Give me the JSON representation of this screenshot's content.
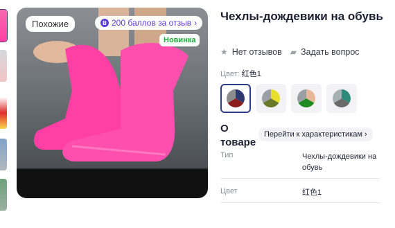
{
  "gallery": {
    "similar_label": "Похожие",
    "bonus_icon": "B",
    "bonus_label": "200 баллов за отзыв",
    "new_badge": "Новинка"
  },
  "product": {
    "title": "Чехлы-дождевики на обувь",
    "no_reviews": "Нет отзывов",
    "ask_question": "Задать вопрос",
    "color_prefix": "Цвет: ",
    "color_value": "红色1",
    "swatches": [
      {
        "name": "navy-red-grey",
        "colors": [
          "#2e3870",
          "#8a1c1c",
          "#8c8c8c"
        ],
        "selected": true
      },
      {
        "name": "yellow-olive-grey",
        "colors": [
          "#e8e02a",
          "#6b7a2a",
          "#9aa0a6"
        ],
        "selected": false
      },
      {
        "name": "peach-green-grey",
        "colors": [
          "#e8b89a",
          "#1f8a1f",
          "#9aa0a6"
        ],
        "selected": false
      },
      {
        "name": "teal-grey",
        "colors": [
          "#2e8a7a",
          "#6b6b6b",
          "#a7b0b5"
        ],
        "selected": false
      }
    ]
  },
  "about": {
    "heading": "О товаре",
    "goto_label": "Перейти к характеристикам",
    "specs": [
      {
        "key": "Тип",
        "value": "Чехлы-дождевики на обувь"
      },
      {
        "key": "Цвет",
        "value": "红色1"
      }
    ]
  },
  "colors": {
    "accent": "#5a3dd6",
    "new_badge": "#1aab3b",
    "product_pink": "#ff3fa4"
  }
}
